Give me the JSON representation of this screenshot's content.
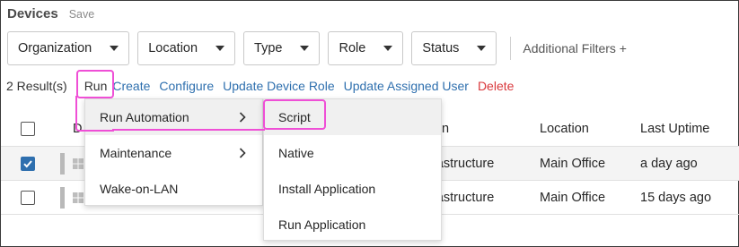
{
  "header": {
    "title": "Devices",
    "save_label": "Save"
  },
  "filters": {
    "items": [
      {
        "label": "Organization"
      },
      {
        "label": "Location"
      },
      {
        "label": "Type"
      },
      {
        "label": "Role"
      },
      {
        "label": "Status"
      }
    ],
    "additional": "Additional Filters +"
  },
  "actions": {
    "results": "2 Result(s)",
    "run": "Run",
    "create": "Create",
    "configure": "Configure",
    "update_role": "Update Device Role",
    "update_user": "Update Assigned User",
    "delete": "Delete"
  },
  "table": {
    "columns": {
      "device": "D",
      "department": "n",
      "location": "Location",
      "uptime": "Last Uptime"
    },
    "rows": [
      {
        "checked": true,
        "department": "rastructure",
        "location": "Main Office",
        "uptime": "a day ago"
      },
      {
        "checked": false,
        "department": "rastructure",
        "location": "Main Office",
        "uptime": "15 days ago"
      }
    ]
  },
  "run_menu": {
    "items": [
      {
        "label": "Run Automation",
        "has_submenu": true
      },
      {
        "label": "Maintenance",
        "has_submenu": true
      },
      {
        "label": "Wake-on-LAN",
        "has_submenu": false
      }
    ]
  },
  "automation_submenu": {
    "items": [
      {
        "label": "Script"
      },
      {
        "label": "Native"
      },
      {
        "label": "Install Application"
      },
      {
        "label": "Run Application"
      }
    ]
  },
  "colors": {
    "link": "#2e6fae",
    "danger": "#d9373b",
    "highlight": "#ef4fd6",
    "checkbox_checked": "#2e6fae"
  },
  "icons": {
    "filter_caret": "caret-down-icon",
    "submenu_chevron": "chevron-right-icon",
    "device_os": "windows-icon",
    "checkbox_check": "check-icon"
  }
}
